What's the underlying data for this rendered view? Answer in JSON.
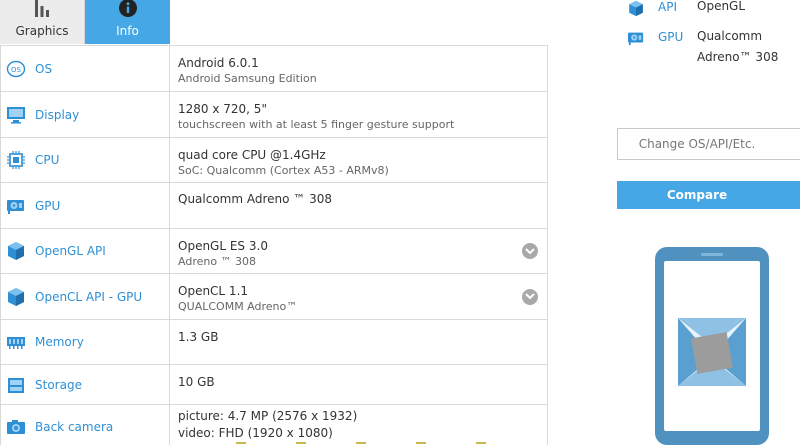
{
  "tabs": [
    {
      "label": "Graphics",
      "icon": "bar-chart-icon",
      "active": false
    },
    {
      "label": "Info",
      "icon": "info-icon",
      "active": true
    }
  ],
  "rows": [
    {
      "key": "os",
      "icon": "os-icon",
      "label": "OS",
      "value": "Android 6.0.1",
      "sub": "Android Samsung Edition",
      "expandable": false
    },
    {
      "key": "display",
      "icon": "monitor-icon",
      "label": "Display",
      "value": "1280 x 720, 5\"",
      "sub": "touchscreen with at least 5 finger gesture support",
      "expandable": false
    },
    {
      "key": "cpu",
      "icon": "cpu-icon",
      "label": "CPU",
      "value": "quad core CPU @1.4GHz",
      "sub": "SoC: Qualcomm (Cortex A53 - ARMv8)",
      "expandable": false
    },
    {
      "key": "gpu",
      "icon": "gpu-icon",
      "label": "GPU",
      "value": "Qualcomm Adreno ™ 308",
      "sub": "",
      "expandable": false
    },
    {
      "key": "opengl",
      "icon": "cube-icon",
      "label": "OpenGL API",
      "value": "OpenGL ES 3.0",
      "sub": "Adreno ™ 308",
      "expandable": true
    },
    {
      "key": "opencl",
      "icon": "cube-icon",
      "label": "OpenCL API - GPU",
      "value": "OpenCL 1.1",
      "sub": "QUALCOMM Adreno™",
      "expandable": true
    },
    {
      "key": "memory",
      "icon": "memory-icon",
      "label": "Memory",
      "value": "1.3 GB",
      "sub": "",
      "expandable": false
    },
    {
      "key": "storage",
      "icon": "storage-icon",
      "label": "Storage",
      "value": "10 GB",
      "sub": "",
      "expandable": false
    },
    {
      "key": "camera",
      "icon": "camera-icon",
      "label": "Back camera",
      "value": "picture: 4.7 MP (2576 x 1932)",
      "sub": "video: FHD (1920 x 1080)",
      "expandable": false
    }
  ],
  "right_panel": {
    "api": {
      "label": "API",
      "value": "OpenGL"
    },
    "gpu": {
      "label": "GPU",
      "value_line1": "Qualcomm",
      "value_line2": "Adreno™ 308"
    },
    "change_button": "Change OS/API/Etc.",
    "compare_button": "Compare"
  },
  "colors": {
    "accent": "#45a7e5",
    "label_blue": "#2f8fd4",
    "phone_frame": "#4f91bf"
  }
}
